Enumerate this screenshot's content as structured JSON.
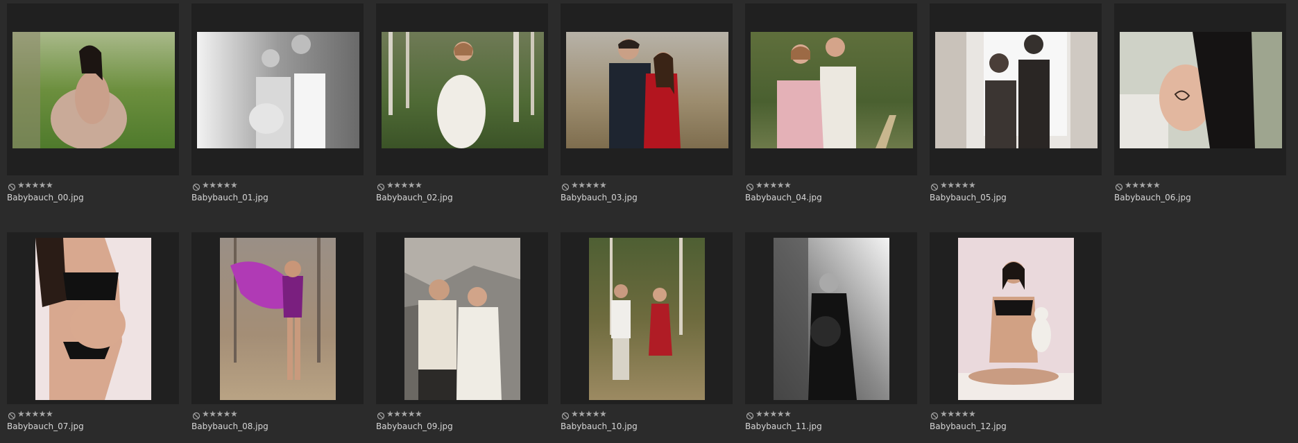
{
  "gallery": {
    "star_glyphs": "★★★★★",
    "colors": {
      "background": "#2b2b2b",
      "cell": "#202020",
      "text": "#d6d6d6",
      "stars": "#a7a7a7"
    },
    "items": [
      {
        "filename": "Babybauch_00.jpg",
        "orientation": "landscape",
        "rating": 0,
        "icon": "reject-icon"
      },
      {
        "filename": "Babybauch_01.jpg",
        "orientation": "landscape",
        "rating": 0,
        "icon": "reject-icon"
      },
      {
        "filename": "Babybauch_02.jpg",
        "orientation": "landscape",
        "rating": 0,
        "icon": "reject-icon"
      },
      {
        "filename": "Babybauch_03.jpg",
        "orientation": "landscape",
        "rating": 0,
        "icon": "reject-icon"
      },
      {
        "filename": "Babybauch_04.jpg",
        "orientation": "landscape",
        "rating": 0,
        "icon": "reject-icon"
      },
      {
        "filename": "Babybauch_05.jpg",
        "orientation": "landscape",
        "rating": 0,
        "icon": "reject-icon"
      },
      {
        "filename": "Babybauch_06.jpg",
        "orientation": "landscape",
        "rating": 0,
        "icon": "reject-icon"
      },
      {
        "filename": "Babybauch_07.jpg",
        "orientation": "portrait",
        "rating": 0,
        "icon": "reject-icon"
      },
      {
        "filename": "Babybauch_08.jpg",
        "orientation": "portrait",
        "rating": 0,
        "icon": "reject-icon"
      },
      {
        "filename": "Babybauch_09.jpg",
        "orientation": "portrait",
        "rating": 0,
        "icon": "reject-icon"
      },
      {
        "filename": "Babybauch_10.jpg",
        "orientation": "portrait",
        "rating": 0,
        "icon": "reject-icon"
      },
      {
        "filename": "Babybauch_11.jpg",
        "orientation": "portrait",
        "rating": 0,
        "icon": "reject-icon"
      },
      {
        "filename": "Babybauch_12.jpg",
        "orientation": "portrait",
        "rating": 0,
        "icon": "reject-icon"
      }
    ]
  }
}
